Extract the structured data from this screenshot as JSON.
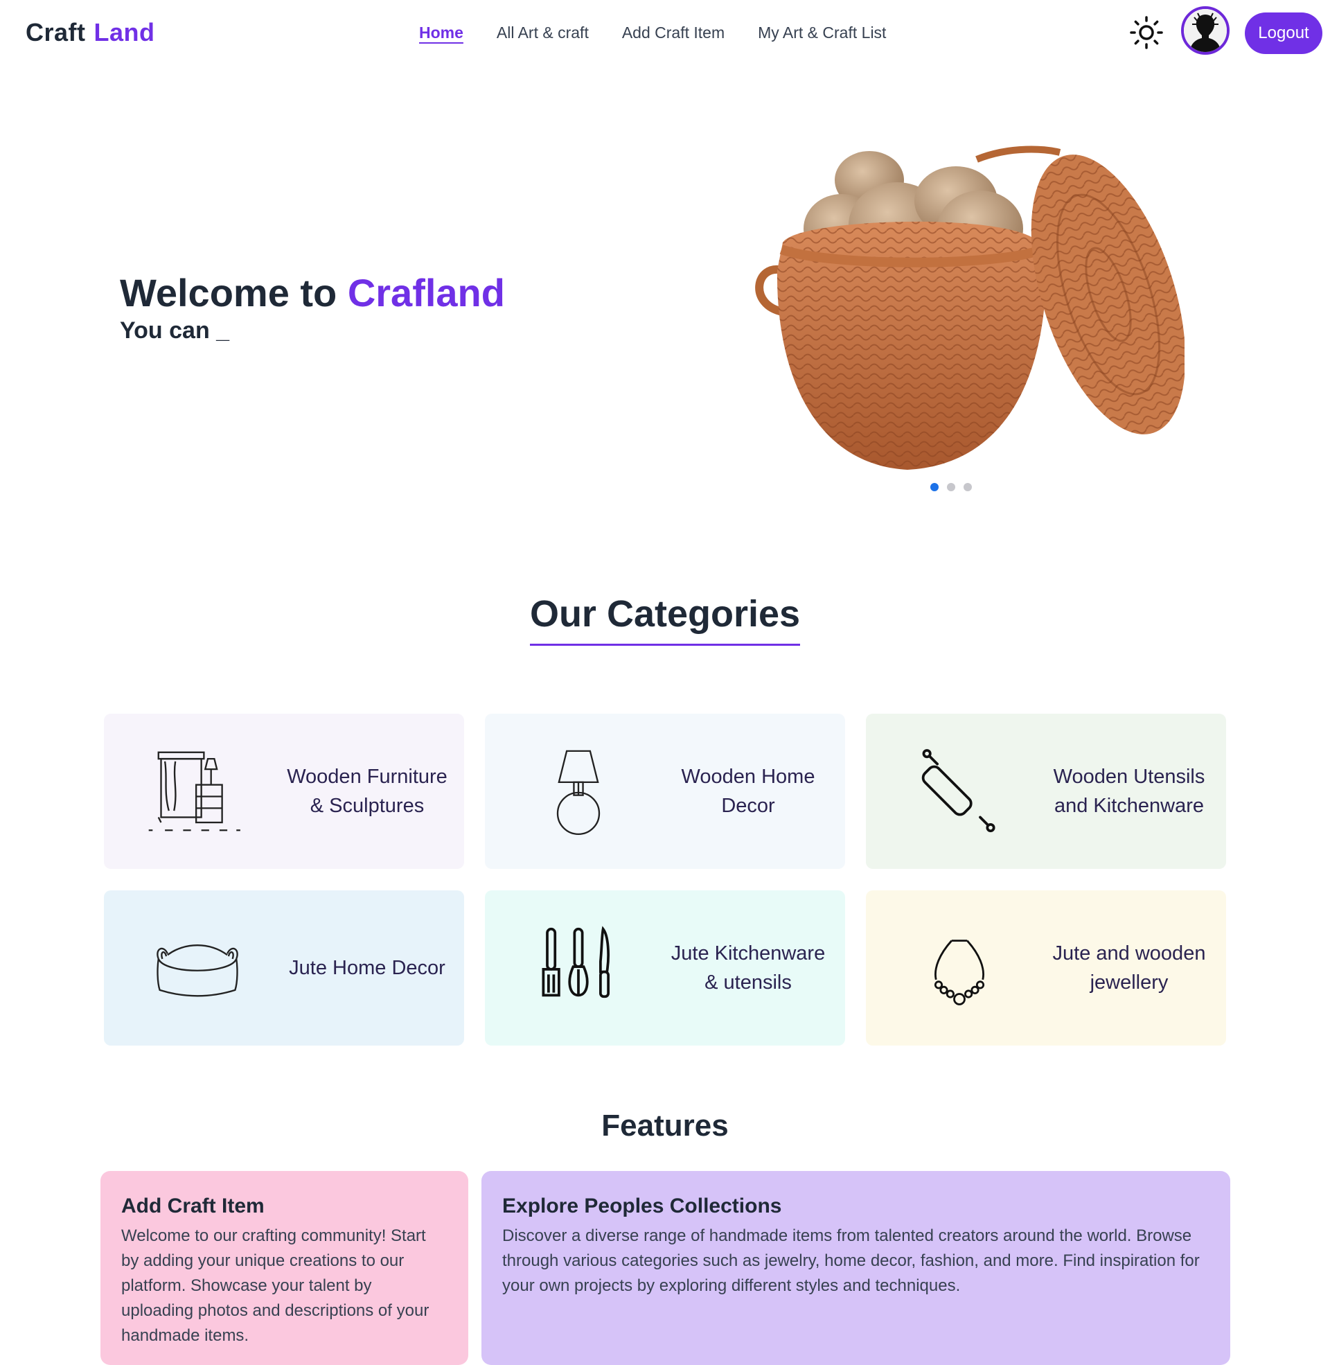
{
  "brand": {
    "part1": "Craft",
    "part2": "Land"
  },
  "nav": {
    "links": [
      {
        "label": "Home",
        "active": true
      },
      {
        "label": "All Art & craft",
        "active": false
      },
      {
        "label": "Add Craft Item",
        "active": false
      },
      {
        "label": "My Art & Craft List",
        "active": false
      }
    ],
    "theme_icon": "sun-icon",
    "logout_label": "Logout"
  },
  "hero": {
    "title_prefix": "Welcome to ",
    "title_accent": "Crafland",
    "subtitle": "You can _",
    "slide_count": 3,
    "active_slide": 1
  },
  "categories": {
    "heading": "Our Categories",
    "items": [
      {
        "label": "Wooden Furniture & Sculptures",
        "icon": "furniture-icon",
        "bg": "#f7f4fb"
      },
      {
        "label": "Wooden Home Decor",
        "icon": "lamp-icon",
        "bg": "#f3f8fc"
      },
      {
        "label": "Wooden Utensils and Kitchenware",
        "icon": "rolling-pin-icon",
        "bg": "#eff6ee"
      },
      {
        "label": "Jute Home Decor",
        "icon": "basket-icon",
        "bg": "#e7f3fa"
      },
      {
        "label": "Jute Kitchenware & utensils",
        "icon": "kitchen-utensils-icon",
        "bg": "#e8fbf8"
      },
      {
        "label": "Jute and wooden jewellery",
        "icon": "necklace-icon",
        "bg": "#fdf9e8"
      }
    ]
  },
  "features": {
    "heading": "Features",
    "cards": [
      {
        "title": "Add Craft Item",
        "text": "Welcome to our crafting community! Start by adding your unique creations to our platform. Showcase your talent by uploading photos and descriptions of your handmade items.",
        "bg": "#fbc8de"
      },
      {
        "title": "Explore Peoples Collections",
        "text": "Discover a diverse range of handmade items from talented creators around the world. Browse through various categories such as jewelry, home decor, fashion, and more. Find inspiration for your own projects by exploring different styles and techniques.",
        "bg": "#d6c3f8"
      }
    ]
  },
  "colors": {
    "accent": "#7030e6",
    "dark_text": "#1f2937",
    "dot_active": "#1d72e8"
  }
}
